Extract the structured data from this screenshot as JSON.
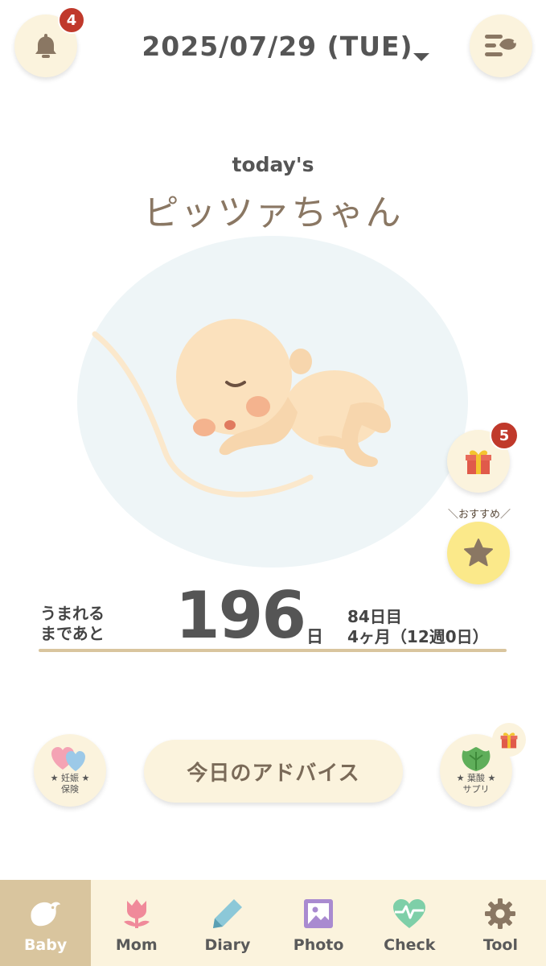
{
  "header": {
    "date": "2025/07/29 (TUE)",
    "notification_count": "4"
  },
  "hero": {
    "today_label": "today's",
    "baby_name": "ピッツァちゃん"
  },
  "side": {
    "gift_count": "5",
    "recommend_label": "＼おすすめ／"
  },
  "countdown": {
    "label_line1": "うまれる",
    "label_line2": "まであと",
    "days_left": "196",
    "days_unit": "日",
    "day_count": "84日目",
    "month_week": "4ヶ月（12週0日）"
  },
  "actions": {
    "insurance_line1": "★ 妊娠 ★",
    "insurance_line2": "保険",
    "advice_label": "今日のアドバイス",
    "supplement_line1": "★ 葉酸 ★",
    "supplement_line2": "サプリ"
  },
  "tabs": [
    {
      "label": "Baby",
      "icon": "bird-icon",
      "active": true
    },
    {
      "label": "Mom",
      "icon": "tulip-icon"
    },
    {
      "label": "Diary",
      "icon": "pencil-icon"
    },
    {
      "label": "Photo",
      "icon": "photo-icon"
    },
    {
      "label": "Check",
      "icon": "heartbeat-icon"
    },
    {
      "label": "Tool",
      "icon": "gear-icon"
    }
  ],
  "colors": {
    "accent": "#d9c59e",
    "button_bg": "#fbf3dd",
    "badge": "#c0392b",
    "womb": "#eef5f7"
  }
}
